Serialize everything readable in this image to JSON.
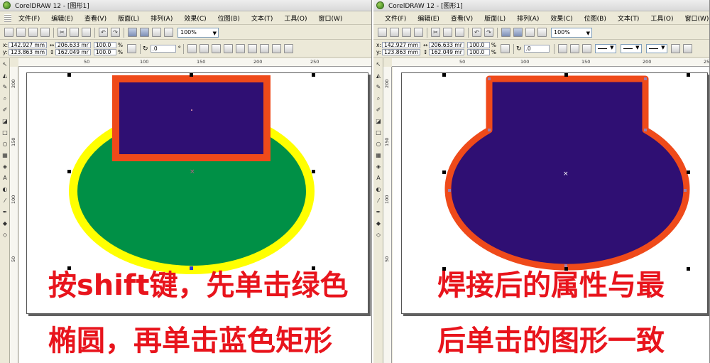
{
  "window": {
    "title": "CorelDRAW 12 - [图形1]"
  },
  "menu": [
    "文件(F)",
    "编辑(E)",
    "查看(V)",
    "版面(L)",
    "排列(A)",
    "效果(C)",
    "位图(B)",
    "文本(T)",
    "工具(O)",
    "窗口(W)"
  ],
  "zoom": "100%",
  "properties": {
    "x": "142.927 mm",
    "y": "123.863 mm",
    "width": "206.633 mr",
    "height": "162.049 mr",
    "scale_x": "100.0",
    "scale_y": "100.0",
    "percent": "%",
    "rotation": ".0",
    "x_label": "x:",
    "y_label": "y:",
    "degree": "°"
  },
  "ruler_top": [
    "50",
    "100",
    "150",
    "200",
    "250"
  ],
  "ruler_left": [
    "200",
    "150",
    "100",
    "50"
  ],
  "captions": {
    "left_line1": "按shift键，先单击绿色",
    "left_line2": "椭圆，再单击蓝色矩形",
    "right_line1": "焊接后的属性与最",
    "right_line2": "后单击的图形一致"
  },
  "colors": {
    "ellipse_fill": "#009046",
    "ellipse_outline": "#ffff00",
    "rect_fill": "#2f0f73",
    "rect_outline": "#ef4a1a",
    "merged_fill": "#2f0f73",
    "merged_outline": "#ef4a1a",
    "caption": "#e8141c"
  },
  "icons": {
    "new": "new-document-icon",
    "open": "open-folder-icon",
    "save": "save-icon",
    "print": "print-icon",
    "cut": "cut-icon",
    "copy": "copy-icon",
    "paste": "paste-icon",
    "undo": "undo-icon",
    "redo": "redo-icon",
    "import": "import-icon",
    "export": "export-icon",
    "launcher": "application-launcher-icon",
    "corel": "corel-online-icon",
    "lock": "lock-ratio-icon",
    "mirror": "mirror-icon",
    "weld": "weld-icon",
    "pick": "pick-tool-icon",
    "shape": "shape-tool-icon",
    "zoom": "zoom-tool-icon",
    "freehand": "freehand-tool-icon",
    "rectangle": "rectangle-tool-icon",
    "ellipse": "ellipse-tool-icon",
    "polygon": "polygon-tool-icon",
    "text": "text-tool-icon",
    "fill": "fill-tool-icon",
    "outline": "outline-tool-icon"
  }
}
